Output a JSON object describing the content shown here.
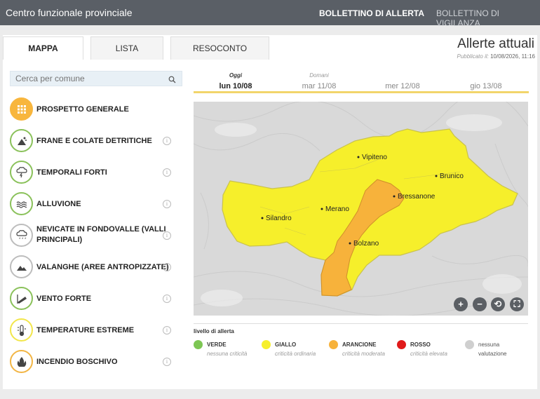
{
  "header": {
    "brand": "Centro funzionale provinciale",
    "nav_allerta": "BOLLETTINO DI ALLERTA",
    "nav_vigilanza": "BOLLETTINO DI VIGILANZA"
  },
  "tabs": [
    {
      "label": "MAPPA",
      "active": true
    },
    {
      "label": "LISTA",
      "active": false
    },
    {
      "label": "RESOCONTO",
      "active": false
    }
  ],
  "page_title": "Allerte attuali",
  "published_label": "Pubblicato il:",
  "published_value": "10/08/2026, 11:16",
  "search": {
    "placeholder": "Cerca per comune",
    "icon": "search-icon"
  },
  "categories": [
    {
      "label": "PROSPETTO GENERALE",
      "icon": "grid-icon"
    },
    {
      "label": "FRANE E COLATE DETRITICHE",
      "icon": "landslide-icon"
    },
    {
      "label": "TEMPORALI FORTI",
      "icon": "thunderstorm-icon"
    },
    {
      "label": "ALLUVIONE",
      "icon": "flood-icon"
    },
    {
      "label": "NEVICATE IN FONDOVALLE (VALLI PRINCIPALI)",
      "icon": "snowfall-icon"
    },
    {
      "label": "VALANGHE (AREE ANTROPIZZATE)",
      "icon": "avalanche-icon"
    },
    {
      "label": "VENTO FORTE",
      "icon": "windsock-icon"
    },
    {
      "label": "TEMPERATURE ESTREME",
      "icon": "thermometer-icon"
    },
    {
      "label": "INCENDIO BOSCHIVO",
      "icon": "fire-icon"
    }
  ],
  "days": [
    {
      "label": "Oggi",
      "date": "lun 10/08",
      "active": true
    },
    {
      "label": "Domani",
      "date": "mar 11/08",
      "active": false
    },
    {
      "label": "",
      "date": "mer 12/08",
      "active": false
    },
    {
      "label": "",
      "date": "gio 13/08",
      "active": false
    }
  ],
  "map": {
    "cities": [
      "Vipiteno",
      "Brunico",
      "Bressanone",
      "Merano",
      "Silandro",
      "Bolzano"
    ],
    "controls": [
      "+",
      "−",
      "⟲",
      "⛶"
    ]
  },
  "legend": {
    "title": "livello di allerta",
    "items": [
      {
        "name": "VERDE",
        "desc": "nessuna criticità",
        "color": "#7dc654"
      },
      {
        "name": "GIALLO",
        "desc": "criticità ordinaria",
        "color": "#f6ef2b"
      },
      {
        "name": "ARANCIONE",
        "desc": "criticità moderata",
        "color": "#f7b23b"
      },
      {
        "name": "ROSSO",
        "desc": "criticità elevata",
        "color": "#e01a1a"
      },
      {
        "name": "nessuna",
        "desc": "valutazione",
        "color": "#cfcfcf"
      }
    ]
  }
}
